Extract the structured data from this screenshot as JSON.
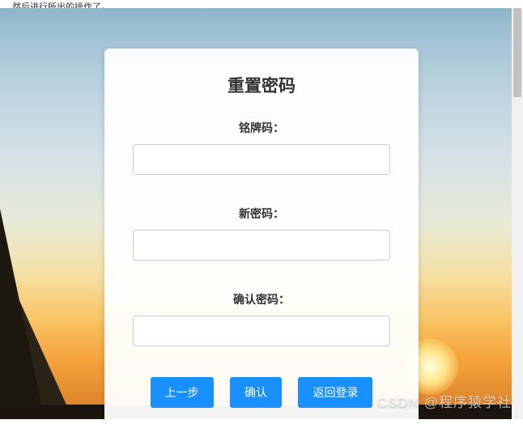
{
  "topFragment": "…然后进行所出的操作了。",
  "form": {
    "title": "重置密码",
    "fields": {
      "badgeCode": {
        "label": "铭牌码：",
        "value": ""
      },
      "newPassword": {
        "label": "新密码：",
        "value": ""
      },
      "confirmPassword": {
        "label": "确认密码：",
        "value": ""
      }
    },
    "buttons": {
      "prev": "上一步",
      "confirm": "确认",
      "backToLogin": "返回登录"
    }
  },
  "watermark": "CSDN @程序猿学社"
}
